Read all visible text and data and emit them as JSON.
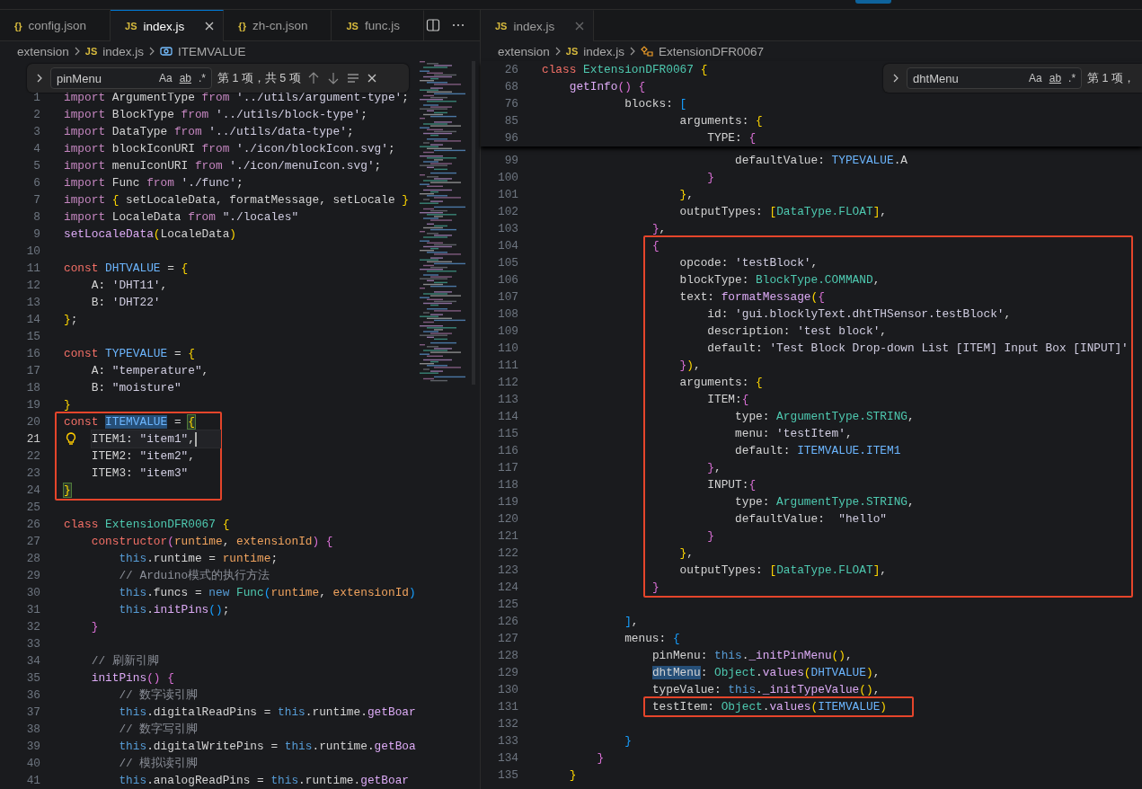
{
  "panes": [
    {
      "focused": true,
      "tabs": [
        {
          "icon": "{}",
          "label": "config.json",
          "selected": false
        },
        {
          "icon": "JS",
          "label": "index.js",
          "selected": true
        },
        {
          "icon": "{}",
          "label": "zh-cn.json",
          "selected": false
        },
        {
          "icon": "JS",
          "label": "func.js",
          "selected": false
        }
      ],
      "tab_actions": [
        {
          "kind": "split"
        },
        {
          "kind": "more"
        }
      ],
      "breadcrumb": [
        {
          "kind": "folder",
          "label": "extension"
        },
        {
          "kind": "file",
          "icon": "JS",
          "label": "index.js"
        },
        {
          "kind": "variable",
          "label": "ITEMVALUE"
        }
      ],
      "find": {
        "value": "pinMenu",
        "options": [
          "Aa",
          "ab",
          ".*"
        ],
        "result": "第 1 项，共 5 项",
        "controls": [
          {
            "kind": "prev"
          },
          {
            "kind": "next"
          },
          {
            "kind": "selection"
          },
          {
            "kind": "close"
          }
        ]
      },
      "editor": {
        "minimap": true,
        "lines": [
          {
            "kind": "line",
            "number": "1",
            "current": false,
            "tokens": [
              {
                "text": "import",
                "kind": "kw"
              },
              {
                "text": " ArgumentType "
              },
              {
                "text": "from",
                "kind": "kw"
              },
              {
                "text": " '../utils/argument-type'",
                "kind": "str"
              },
              {
                "text": ";"
              }
            ]
          },
          {
            "kind": "line",
            "number": "2",
            "current": false,
            "tokens": [
              {
                "text": "import",
                "kind": "kw"
              },
              {
                "text": " BlockType "
              },
              {
                "text": "from",
                "kind": "kw"
              },
              {
                "text": " '../utils/block-type'",
                "kind": "str"
              },
              {
                "text": ";"
              }
            ]
          },
          {
            "kind": "line",
            "number": "3",
            "current": false,
            "tokens": [
              {
                "text": "import",
                "kind": "kw"
              },
              {
                "text": " DataType "
              },
              {
                "text": "from",
                "kind": "kw"
              },
              {
                "text": " '../utils/data-type'",
                "kind": "str"
              },
              {
                "text": ";"
              }
            ]
          },
          {
            "kind": "line",
            "number": "4",
            "current": false,
            "tokens": [
              {
                "text": "import",
                "kind": "kw"
              },
              {
                "text": " blockIconURI "
              },
              {
                "text": "from",
                "kind": "kw"
              },
              {
                "text": " './icon/blockIcon.svg'",
                "kind": "str"
              },
              {
                "text": ";"
              }
            ]
          },
          {
            "kind": "line",
            "number": "5",
            "current": false,
            "tokens": [
              {
                "text": "import",
                "kind": "kw"
              },
              {
                "text": " menuIconURI "
              },
              {
                "text": "from",
                "kind": "kw"
              },
              {
                "text": " './icon/menuIcon.svg'",
                "kind": "str"
              },
              {
                "text": ";"
              }
            ]
          },
          {
            "kind": "line",
            "number": "6",
            "current": false,
            "tokens": [
              {
                "text": "import",
                "kind": "kw"
              },
              {
                "text": " Func "
              },
              {
                "text": "from",
                "kind": "kw"
              },
              {
                "text": " './func'",
                "kind": "str"
              },
              {
                "text": ";"
              }
            ]
          },
          {
            "kind": "line",
            "number": "7",
            "current": false,
            "tokens": [
              {
                "text": "import",
                "kind": "kw"
              },
              {
                "text": " {",
                "kind": "b1"
              },
              {
                "text": " setLocaleData, formatMessage, setLocale "
              },
              {
                "text": "}",
                "kind": "b1"
              }
            ]
          },
          {
            "kind": "line",
            "number": "8",
            "current": false,
            "tokens": [
              {
                "text": "import",
                "kind": "kw"
              },
              {
                "text": " LocaleData "
              },
              {
                "text": "from",
                "kind": "kw"
              },
              {
                "text": " \"./locales\"",
                "kind": "str"
              }
            ]
          },
          {
            "kind": "line",
            "number": "9",
            "current": false,
            "tokens": [
              {
                "text": "setLocaleData",
                "kind": "fn"
              },
              {
                "text": "(",
                "kind": "b1"
              },
              {
                "text": "LocaleData"
              },
              {
                "text": ")",
                "kind": "b1"
              }
            ]
          },
          {
            "kind": "line",
            "number": "10",
            "current": false
          },
          {
            "kind": "line",
            "number": "11",
            "current": false,
            "tokens": [
              {
                "text": "const",
                "kind": "key"
              },
              {
                "text": " DHTVALUE",
                "kind": "var"
              },
              {
                "text": " = "
              },
              {
                "text": "{",
                "kind": "b1"
              }
            ]
          },
          {
            "kind": "line",
            "number": "12",
            "current": false,
            "tokens": [
              {
                "text": "    A: "
              },
              {
                "text": "'DHT11'",
                "kind": "str"
              },
              {
                "text": ","
              }
            ]
          },
          {
            "kind": "line",
            "number": "13",
            "current": false,
            "tokens": [
              {
                "text": "    B: "
              },
              {
                "text": "'DHT22'",
                "kind": "str"
              }
            ]
          },
          {
            "kind": "line",
            "number": "14",
            "current": false,
            "tokens": [
              {
                "text": "}",
                "kind": "b1"
              },
              {
                "text": ";"
              }
            ]
          },
          {
            "kind": "line",
            "number": "15",
            "current": false
          },
          {
            "kind": "line",
            "number": "16",
            "current": false,
            "tokens": [
              {
                "text": "const",
                "kind": "key"
              },
              {
                "text": " TYPEVALUE",
                "kind": "var"
              },
              {
                "text": " = "
              },
              {
                "text": "{",
                "kind": "b1"
              }
            ]
          },
          {
            "kind": "line",
            "number": "17",
            "current": false,
            "tokens": [
              {
                "text": "    A: "
              },
              {
                "text": "\"temperature\"",
                "kind": "str"
              },
              {
                "text": ","
              }
            ]
          },
          {
            "kind": "line",
            "number": "18",
            "current": false,
            "tokens": [
              {
                "text": "    B: "
              },
              {
                "text": "\"moisture\"",
                "kind": "str"
              }
            ]
          },
          {
            "kind": "line",
            "number": "19",
            "current": false,
            "tokens": [
              {
                "text": "}",
                "kind": "b1"
              }
            ]
          },
          {
            "kind": "highlight_box",
            "lines": [
              {
                "kind": "line",
                "number": "20",
                "current": false,
                "tokens": [
                  {
                    "text": "const ",
                    "kind": "key"
                  },
                  {
                    "text": "ITEMVALUE",
                    "kind": "var",
                    "highlighted": true
                  },
                  {
                    "text": " = "
                  },
                  {
                    "text": "{",
                    "kind": "b1",
                    "bracket_match": true
                  }
                ]
              },
              {
                "kind": "line",
                "number": "21",
                "current": true,
                "tokens": [
                  {
                    "text": "    ITEM1: "
                  },
                  {
                    "text": "\"item1\"",
                    "kind": "str"
                  },
                  {
                    "text": ","
                  }
                ]
              },
              {
                "kind": "line",
                "number": "22",
                "current": false,
                "tokens": [
                  {
                    "text": "    ITEM2: "
                  },
                  {
                    "text": "\"item2\"",
                    "kind": "str"
                  },
                  {
                    "text": ","
                  }
                ]
              },
              {
                "kind": "line",
                "number": "23",
                "current": false,
                "tokens": [
                  {
                    "text": "    ITEM3: "
                  },
                  {
                    "text": "\"item3\"",
                    "kind": "str"
                  }
                ]
              },
              {
                "kind": "line",
                "number": "24",
                "current": false,
                "tokens": [
                  {
                    "text": "}",
                    "kind": "b1",
                    "bracket_match": true
                  }
                ]
              }
            ]
          },
          {
            "kind": "line",
            "number": "25",
            "current": false
          },
          {
            "kind": "line",
            "number": "26",
            "current": false,
            "tokens": [
              {
                "text": "class",
                "kind": "key"
              },
              {
                "text": " ExtensionDFR0067",
                "kind": "cls"
              },
              {
                "text": " {",
                "kind": "b1"
              }
            ]
          },
          {
            "kind": "line",
            "number": "27",
            "current": false,
            "tokens": [
              {
                "text": "    constructor",
                "kind": "key"
              },
              {
                "text": "(",
                "kind": "b2"
              },
              {
                "text": "runtime",
                "kind": "prm"
              },
              {
                "text": ", "
              },
              {
                "text": "extensionId",
                "kind": "prm"
              },
              {
                "text": ")",
                "kind": "b2"
              },
              {
                "text": " {",
                "kind": "b2"
              }
            ]
          },
          {
            "kind": "line",
            "number": "28",
            "current": false,
            "tokens": [
              {
                "text": "        this",
                "kind": "this"
              },
              {
                "text": ".runtime = "
              },
              {
                "text": "runtime",
                "kind": "prm"
              },
              {
                "text": ";"
              }
            ]
          },
          {
            "kind": "line",
            "number": "29",
            "current": false,
            "tokens": [
              {
                "text": "        // Arduino模式的执行方法",
                "kind": "cm"
              }
            ]
          },
          {
            "kind": "line",
            "number": "30",
            "current": false,
            "tokens": [
              {
                "text": "        this",
                "kind": "this"
              },
              {
                "text": ".funcs = "
              },
              {
                "text": "new",
                "kind": "this"
              },
              {
                "text": " Func",
                "kind": "cls"
              },
              {
                "text": "(",
                "kind": "b3"
              },
              {
                "text": "runtime",
                "kind": "prm"
              },
              {
                "text": ", "
              },
              {
                "text": "extensionId",
                "kind": "prm"
              },
              {
                "text": ")",
                "kind": "b3"
              }
            ]
          },
          {
            "kind": "line",
            "number": "31",
            "current": false,
            "tokens": [
              {
                "text": "        this",
                "kind": "this"
              },
              {
                "text": "."
              },
              {
                "text": "initPins",
                "kind": "fn"
              },
              {
                "text": "()",
                "kind": "b3"
              },
              {
                "text": ";"
              }
            ]
          },
          {
            "kind": "line",
            "number": "32",
            "current": false,
            "tokens": [
              {
                "text": "    }",
                "kind": "b2"
              }
            ]
          },
          {
            "kind": "line",
            "number": "33",
            "current": false
          },
          {
            "kind": "line",
            "number": "34",
            "current": false,
            "tokens": [
              {
                "text": "    // 刷新引脚",
                "kind": "cm"
              }
            ]
          },
          {
            "kind": "line",
            "number": "35",
            "current": false,
            "tokens": [
              {
                "text": "    initPins",
                "kind": "fn"
              },
              {
                "text": "()",
                "kind": "b2"
              },
              {
                "text": " {",
                "kind": "b2"
              }
            ]
          },
          {
            "kind": "line",
            "number": "36",
            "current": false,
            "tokens": [
              {
                "text": "        // 数字读引脚",
                "kind": "cm"
              }
            ]
          },
          {
            "kind": "line",
            "number": "37",
            "current": false,
            "tokens": [
              {
                "text": "        this",
                "kind": "this"
              },
              {
                "text": ".digitalReadPins = "
              },
              {
                "text": "this",
                "kind": "this"
              },
              {
                "text": ".runtime."
              },
              {
                "text": "getBoar",
                "kind": "fn"
              }
            ]
          },
          {
            "kind": "line",
            "number": "38",
            "current": false,
            "tokens": [
              {
                "text": "        // 数字写引脚",
                "kind": "cm"
              }
            ]
          },
          {
            "kind": "line",
            "number": "39",
            "current": false,
            "tokens": [
              {
                "text": "        this",
                "kind": "this"
              },
              {
                "text": ".digitalWritePins = "
              },
              {
                "text": "this",
                "kind": "this"
              },
              {
                "text": ".runtime."
              },
              {
                "text": "getBoa",
                "kind": "fn"
              }
            ]
          },
          {
            "kind": "line",
            "number": "40",
            "current": false,
            "tokens": [
              {
                "text": "        // 模拟读引脚",
                "kind": "cm"
              }
            ]
          },
          {
            "kind": "line",
            "number": "41",
            "current": false,
            "tokens": [
              {
                "text": "        this",
                "kind": "this"
              },
              {
                "text": ".analogReadPins = "
              },
              {
                "text": "this",
                "kind": "this"
              },
              {
                "text": ".runtime."
              },
              {
                "text": "getBoar",
                "kind": "fn"
              }
            ]
          }
        ]
      }
    },
    {
      "focused": false,
      "tabs": [
        {
          "icon": "JS",
          "label": "index.js",
          "selected": true
        }
      ],
      "breadcrumb": [
        {
          "kind": "folder",
          "label": "extension"
        },
        {
          "kind": "file",
          "icon": "JS",
          "label": "index.js"
        },
        {
          "kind": "class",
          "label": "ExtensionDFR0067"
        }
      ],
      "find": {
        "value": "dhtMenu",
        "options": [
          "Aa",
          "ab",
          ".*"
        ],
        "result": "第 1 项，"
      },
      "editor": {
        "minimap": false,
        "sticky_lines": [
          {
            "kind": "line",
            "number": "26",
            "tokens": [
              {
                "text": "class",
                "kind": "key"
              },
              {
                "text": " ExtensionDFR0067",
                "kind": "cls"
              },
              {
                "text": " {",
                "kind": "b1"
              }
            ]
          },
          {
            "kind": "line",
            "number": "68",
            "tokens": [
              {
                "text": "    getInfo",
                "kind": "fn"
              },
              {
                "text": "()",
                "kind": "b2"
              },
              {
                "text": " {",
                "kind": "b2"
              }
            ]
          },
          {
            "kind": "line",
            "number": "76",
            "tokens": [
              {
                "text": "            blocks: "
              },
              {
                "text": "[",
                "kind": "b3"
              }
            ]
          },
          {
            "kind": "line",
            "number": "85",
            "tokens": [
              {
                "text": "                    arguments: "
              },
              {
                "text": "{",
                "kind": "b1"
              }
            ]
          },
          {
            "kind": "line",
            "number": "96",
            "tokens": [
              {
                "text": "                        TYPE: "
              },
              {
                "text": "{",
                "kind": "b2"
              }
            ]
          }
        ],
        "lines": [
          {
            "kind": "line",
            "number": "99",
            "tokens": [
              {
                "text": "                            defaultValue: "
              },
              {
                "text": "TYPEVALUE",
                "kind": "var"
              },
              {
                "text": ".A"
              }
            ]
          },
          {
            "kind": "line",
            "number": "100",
            "tokens": [
              {
                "text": "                        }",
                "kind": "b2"
              }
            ]
          },
          {
            "kind": "line",
            "number": "101",
            "tokens": [
              {
                "text": "                    }",
                "kind": "b1"
              },
              {
                "text": ","
              }
            ]
          },
          {
            "kind": "line",
            "number": "102",
            "tokens": [
              {
                "text": "                    outputTypes: "
              },
              {
                "text": "[",
                "kind": "b1"
              },
              {
                "text": "DataType.FLOAT",
                "kind": "cls"
              },
              {
                "text": "]",
                "kind": "b1"
              },
              {
                "text": ","
              }
            ]
          },
          {
            "kind": "line",
            "number": "103",
            "tokens": [
              {
                "text": "                }",
                "kind": "b2"
              },
              {
                "text": ","
              }
            ]
          },
          {
            "kind": "highlight_box",
            "lines": [
              {
                "kind": "line",
                "number": "104",
                "tokens": [
                  {
                    "text": "                {",
                    "kind": "b2"
                  }
                ]
              },
              {
                "kind": "line",
                "number": "105",
                "tokens": [
                  {
                    "text": "                    opcode: "
                  },
                  {
                    "text": "'testBlock'",
                    "kind": "str"
                  },
                  {
                    "text": ","
                  }
                ]
              },
              {
                "kind": "line",
                "number": "106",
                "tokens": [
                  {
                    "text": "                    blockType: "
                  },
                  {
                    "text": "BlockType.COMMAND",
                    "kind": "cls"
                  },
                  {
                    "text": ","
                  }
                ]
              },
              {
                "kind": "line",
                "number": "107",
                "tokens": [
                  {
                    "text": "                    text: "
                  },
                  {
                    "text": "formatMessage",
                    "kind": "fn"
                  },
                  {
                    "text": "(",
                    "kind": "b1"
                  },
                  {
                    "text": "{",
                    "kind": "b2"
                  }
                ]
              },
              {
                "kind": "line",
                "number": "108",
                "tokens": [
                  {
                    "text": "                        id: "
                  },
                  {
                    "text": "'gui.blocklyText.dhtTHSensor.testBlock'",
                    "kind": "str"
                  },
                  {
                    "text": ","
                  }
                ]
              },
              {
                "kind": "line",
                "number": "109",
                "tokens": [
                  {
                    "text": "                        description: "
                  },
                  {
                    "text": "'test block'",
                    "kind": "str"
                  },
                  {
                    "text": ","
                  }
                ]
              },
              {
                "kind": "line",
                "number": "110",
                "tokens": [
                  {
                    "text": "                        default: "
                  },
                  {
                    "text": "'Test Block Drop-down List [ITEM] Input Box [INPUT]'",
                    "kind": "str"
                  }
                ]
              },
              {
                "kind": "line",
                "number": "111",
                "tokens": [
                  {
                    "text": "                    }",
                    "kind": "b2"
                  },
                  {
                    "text": ")",
                    "kind": "b1"
                  },
                  {
                    "text": ","
                  }
                ]
              },
              {
                "kind": "line",
                "number": "112",
                "tokens": [
                  {
                    "text": "                    arguments: "
                  },
                  {
                    "text": "{",
                    "kind": "b1"
                  }
                ]
              },
              {
                "kind": "line",
                "number": "113",
                "tokens": [
                  {
                    "text": "                        ITEM:"
                  },
                  {
                    "text": "{",
                    "kind": "b2"
                  }
                ]
              },
              {
                "kind": "line",
                "number": "114",
                "tokens": [
                  {
                    "text": "                            type: "
                  },
                  {
                    "text": "ArgumentType.STRING",
                    "kind": "cls"
                  },
                  {
                    "text": ","
                  }
                ]
              },
              {
                "kind": "line",
                "number": "115",
                "tokens": [
                  {
                    "text": "                            menu: "
                  },
                  {
                    "text": "'testItem'",
                    "kind": "str"
                  },
                  {
                    "text": ","
                  }
                ]
              },
              {
                "kind": "line",
                "number": "116",
                "tokens": [
                  {
                    "text": "                            default: "
                  },
                  {
                    "text": "ITEMVALUE.ITEM1",
                    "kind": "var"
                  }
                ]
              },
              {
                "kind": "line",
                "number": "117",
                "tokens": [
                  {
                    "text": "                        }",
                    "kind": "b2"
                  },
                  {
                    "text": ","
                  }
                ]
              },
              {
                "kind": "line",
                "number": "118",
                "tokens": [
                  {
                    "text": "                        INPUT:"
                  },
                  {
                    "text": "{",
                    "kind": "b2"
                  }
                ]
              },
              {
                "kind": "line",
                "number": "119",
                "tokens": [
                  {
                    "text": "                            type: "
                  },
                  {
                    "text": "ArgumentType.STRING",
                    "kind": "cls"
                  },
                  {
                    "text": ","
                  }
                ]
              },
              {
                "kind": "line",
                "number": "120",
                "tokens": [
                  {
                    "text": "                            defaultValue:  "
                  },
                  {
                    "text": "\"hello\"",
                    "kind": "str"
                  }
                ]
              },
              {
                "kind": "line",
                "number": "121",
                "tokens": [
                  {
                    "text": "                        }",
                    "kind": "b2"
                  }
                ]
              },
              {
                "kind": "line",
                "number": "122",
                "tokens": [
                  {
                    "text": "                    }",
                    "kind": "b1"
                  },
                  {
                    "text": ","
                  }
                ]
              },
              {
                "kind": "line",
                "number": "123",
                "tokens": [
                  {
                    "text": "                    outputTypes: "
                  },
                  {
                    "text": "[",
                    "kind": "b1"
                  },
                  {
                    "text": "DataType.FLOAT",
                    "kind": "cls"
                  },
                  {
                    "text": "]",
                    "kind": "b1"
                  },
                  {
                    "text": ","
                  }
                ]
              },
              {
                "kind": "line",
                "number": "124",
                "tokens": [
                  {
                    "text": "                }",
                    "kind": "b2"
                  }
                ]
              }
            ]
          },
          {
            "kind": "line",
            "number": "125"
          },
          {
            "kind": "line",
            "number": "126",
            "tokens": [
              {
                "text": "            ]",
                "kind": "b3"
              },
              {
                "text": ","
              }
            ]
          },
          {
            "kind": "line",
            "number": "127",
            "tokens": [
              {
                "text": "            menus: "
              },
              {
                "text": "{",
                "kind": "b3"
              }
            ]
          },
          {
            "kind": "line",
            "number": "128",
            "tokens": [
              {
                "text": "                pinMenu: "
              },
              {
                "text": "this",
                "kind": "this"
              },
              {
                "text": "."
              },
              {
                "text": "_initPinMenu",
                "kind": "fn"
              },
              {
                "text": "()",
                "kind": "b1"
              },
              {
                "text": ","
              }
            ]
          },
          {
            "kind": "line",
            "number": "129",
            "tokens": [
              {
                "text": "                dhtMenu",
                "highlighted": true
              },
              {
                "text": ": "
              },
              {
                "text": "Object",
                "kind": "cls"
              },
              {
                "text": "."
              },
              {
                "text": "values",
                "kind": "fn"
              },
              {
                "text": "(",
                "kind": "b1"
              },
              {
                "text": "DHTVALUE",
                "kind": "var"
              },
              {
                "text": ")",
                "kind": "b1"
              },
              {
                "text": ","
              }
            ]
          },
          {
            "kind": "line",
            "number": "130",
            "tokens": [
              {
                "text": "                typeValue: "
              },
              {
                "text": "this",
                "kind": "this"
              },
              {
                "text": "."
              },
              {
                "text": "_initTypeValue",
                "kind": "fn"
              },
              {
                "text": "()",
                "kind": "b1"
              },
              {
                "text": ","
              }
            ]
          },
          {
            "kind": "highlight_box",
            "lines": [
              {
                "kind": "line",
                "number": "131",
                "tokens": [
                  {
                    "text": "                testItem: "
                  },
                  {
                    "text": "Object",
                    "kind": "cls"
                  },
                  {
                    "text": "."
                  },
                  {
                    "text": "values",
                    "kind": "fn"
                  },
                  {
                    "text": "(",
                    "kind": "b1"
                  },
                  {
                    "text": "ITEMVALUE",
                    "kind": "var"
                  },
                  {
                    "text": ")",
                    "kind": "b1"
                  }
                ]
              }
            ]
          },
          {
            "kind": "line",
            "number": "132"
          },
          {
            "kind": "line",
            "number": "133",
            "tokens": [
              {
                "text": "            }",
                "kind": "b3"
              }
            ]
          },
          {
            "kind": "line",
            "number": "134",
            "tokens": [
              {
                "text": "        }",
                "kind": "b2"
              }
            ]
          },
          {
            "kind": "line",
            "number": "135",
            "tokens": [
              {
                "text": "    }",
                "kind": "b1"
              }
            ]
          }
        ]
      }
    }
  ]
}
